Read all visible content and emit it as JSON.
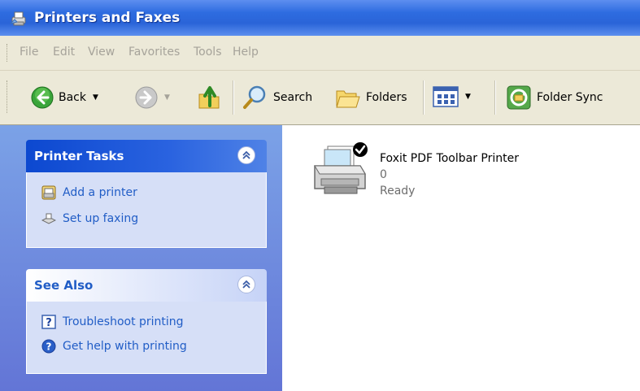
{
  "window": {
    "title": "Printers and Faxes",
    "title_icon": "printers-folder-icon"
  },
  "menu": {
    "items": [
      {
        "label": "File"
      },
      {
        "label": "Edit"
      },
      {
        "label": "View"
      },
      {
        "label": "Favorites"
      },
      {
        "label": "Tools"
      },
      {
        "label": "Help"
      }
    ]
  },
  "toolbar": {
    "back_label": "Back",
    "search_label": "Search",
    "folders_label": "Folders",
    "folder_sync_label": "Folder Sync",
    "icons": [
      "back-arrow-icon",
      "forward-arrow-icon",
      "up-folder-icon",
      "search-magnifier-icon",
      "folders-icon",
      "views-icon",
      "folder-sync-icon"
    ]
  },
  "tasks": {
    "printer_tasks": {
      "title": "Printer Tasks",
      "links": [
        {
          "label": "Add a printer",
          "icon": "add-printer-icon"
        },
        {
          "label": "Set up faxing",
          "icon": "fax-icon"
        }
      ]
    },
    "see_also": {
      "title": "See Also",
      "links": [
        {
          "label": "Troubleshoot printing",
          "icon": "help-topic-icon"
        },
        {
          "label": "Get help with printing",
          "icon": "help-circle-icon"
        }
      ]
    }
  },
  "printers": [
    {
      "name": "Foxit PDF Toolbar Printer",
      "documents": "0",
      "status": "Ready",
      "default": true
    }
  ],
  "colors": {
    "titlebar": "#2a64d8",
    "chrome": "#ece9d8",
    "task_pane": "#6f8edd",
    "panel_body": "#d6dff7",
    "link": "#215dc6"
  }
}
